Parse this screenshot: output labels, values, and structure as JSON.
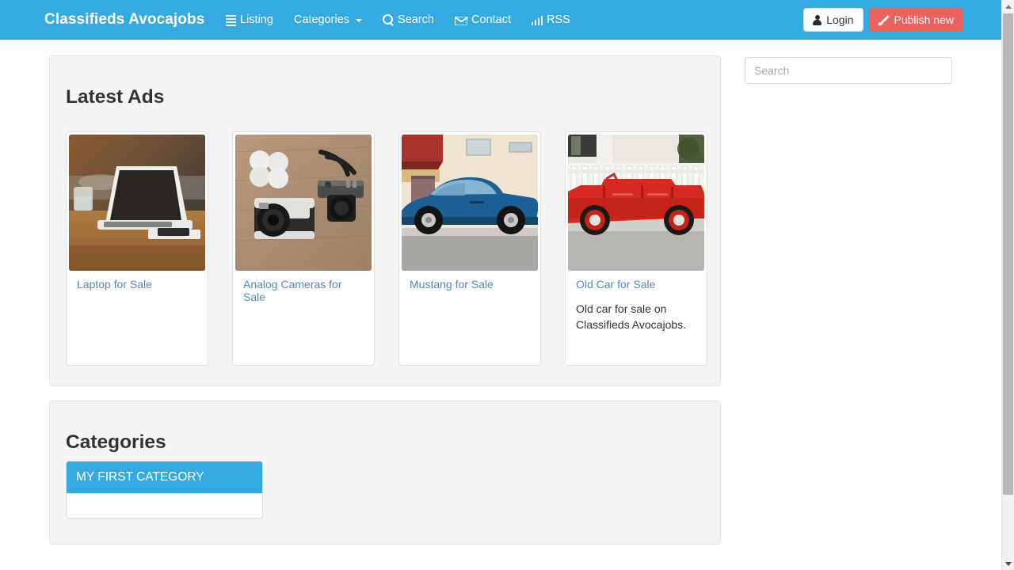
{
  "navbar": {
    "brand": "Classifieds Avocajobs",
    "links": [
      {
        "label": "Listing",
        "icon": "list-icon"
      },
      {
        "label": "Categories",
        "icon": "caret-down-icon"
      },
      {
        "label": "Search",
        "icon": "search-icon"
      },
      {
        "label": "Contact",
        "icon": "envelope-icon"
      },
      {
        "label": "RSS",
        "icon": "signal-icon"
      }
    ],
    "login_label": "Login",
    "publish_label": "Publish new",
    "bg_color": "#35aae1",
    "publish_color": "#e9635c"
  },
  "sidebar": {
    "search_placeholder": "Search",
    "search_value": ""
  },
  "latest": {
    "title": "Latest Ads",
    "ads": [
      {
        "title": "Laptop for Sale",
        "description": "",
        "image": "laptop-on-wooden-desk-photo"
      },
      {
        "title": "Analog Cameras for Sale",
        "description": "",
        "image": "analog-cameras-flatlay-photo"
      },
      {
        "title": "Mustang for Sale",
        "description": "",
        "image": "blue-mustang-car-photo"
      },
      {
        "title": "Old Car for Sale",
        "description": "Old car for sale on Classifieds Avocajobs.",
        "image": "red-vintage-car-photo"
      }
    ]
  },
  "categories": {
    "title": "Categories",
    "items": [
      {
        "label": "MY FIRST CATEGORY"
      }
    ]
  },
  "scrollbar": {
    "up_label": "▲",
    "down_label": "▼"
  }
}
